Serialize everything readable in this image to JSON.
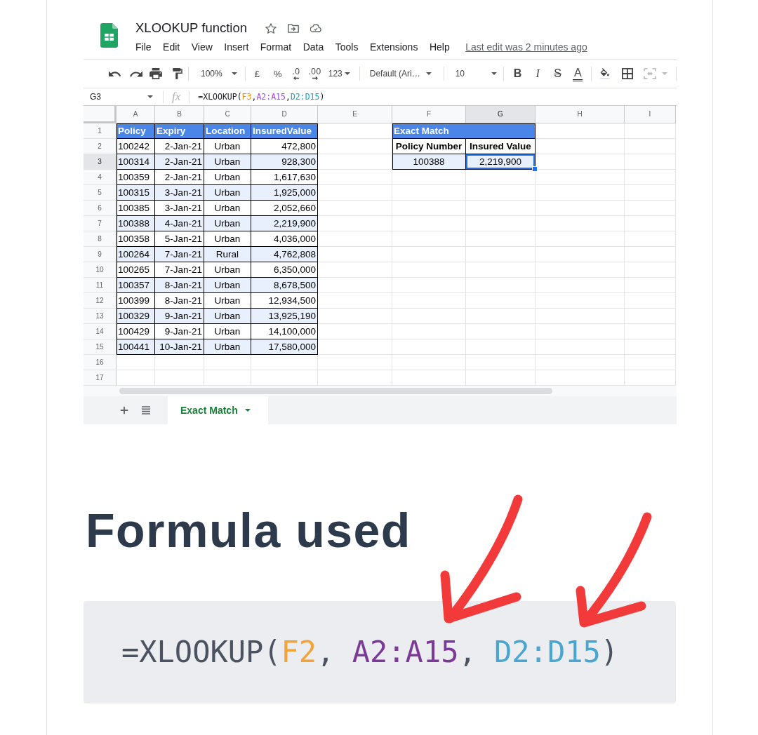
{
  "spreadsheet": {
    "title": "XLOOKUP function",
    "menu": [
      "File",
      "Edit",
      "View",
      "Insert",
      "Format",
      "Data",
      "Tools",
      "Extensions",
      "Help"
    ],
    "last_edit": "Last edit was 2 minutes ago",
    "toolbar": {
      "zoom": "100%",
      "currency": "£",
      "percent": "%",
      "decrease_decimals": ".0",
      "increase_decimals": ".00",
      "number_format": "123",
      "font": "Default (Ari…",
      "font_size": "10",
      "bold": "B",
      "italic": "I",
      "strikethrough": "S",
      "text_color": "A"
    },
    "formula_bar": {
      "cell_ref": "G3",
      "fx_label": "fx",
      "formula": [
        {
          "text": "=XLOOKUP("
        },
        {
          "text": "F3",
          "color": "#f09300"
        },
        {
          "text": ","
        },
        {
          "text": "A2:A15",
          "color": "#a142f4"
        },
        {
          "text": ","
        },
        {
          "text": "D2:D15",
          "color": "#12a4c4"
        },
        {
          "text": ")"
        }
      ]
    },
    "columns": [
      {
        "label": "A",
        "selected": false
      },
      {
        "label": "B",
        "selected": false
      },
      {
        "label": "C",
        "selected": false
      },
      {
        "label": "D",
        "selected": false
      },
      {
        "label": "E",
        "selected": false
      },
      {
        "label": "F",
        "selected": false
      },
      {
        "label": "G",
        "selected": true
      },
      {
        "label": "H",
        "selected": false
      },
      {
        "label": "I",
        "selected": false
      }
    ],
    "rows": [
      {
        "label": "1",
        "selected": false
      },
      {
        "label": "2",
        "selected": false
      },
      {
        "label": "3",
        "selected": true
      },
      {
        "label": "4",
        "selected": false
      },
      {
        "label": "5",
        "selected": false
      },
      {
        "label": "6",
        "selected": false
      },
      {
        "label": "7",
        "selected": false
      },
      {
        "label": "8",
        "selected": false
      },
      {
        "label": "9",
        "selected": false
      },
      {
        "label": "10",
        "selected": false
      },
      {
        "label": "11",
        "selected": false
      },
      {
        "label": "12",
        "selected": false
      },
      {
        "label": "13",
        "selected": false
      },
      {
        "label": "14",
        "selected": false
      },
      {
        "label": "15",
        "selected": false
      },
      {
        "label": "16",
        "selected": false
      },
      {
        "label": "17",
        "selected": false
      }
    ],
    "data_table": {
      "columns": [
        "Policy",
        "Expiry",
        "Location",
        "InsuredValue"
      ],
      "rows": [
        {
          "shaded": false,
          "cells": [
            "100242",
            "2-Jan-21",
            "Urban",
            "472,800"
          ]
        },
        {
          "shaded": true,
          "cells": [
            "100314",
            "2-Jan-21",
            "Urban",
            "928,300"
          ]
        },
        {
          "shaded": false,
          "cells": [
            "100359",
            "2-Jan-21",
            "Urban",
            "1,617,630"
          ]
        },
        {
          "shaded": true,
          "cells": [
            "100315",
            "3-Jan-21",
            "Urban",
            "1,925,000"
          ]
        },
        {
          "shaded": false,
          "cells": [
            "100385",
            "3-Jan-21",
            "Urban",
            "2,052,660"
          ]
        },
        {
          "shaded": true,
          "cells": [
            "100388",
            "4-Jan-21",
            "Urban",
            "2,219,900"
          ]
        },
        {
          "shaded": false,
          "cells": [
            "100358",
            "5-Jan-21",
            "Urban",
            "4,036,000"
          ]
        },
        {
          "shaded": true,
          "cells": [
            "100264",
            "7-Jan-21",
            "Rural",
            "4,762,808"
          ]
        },
        {
          "shaded": false,
          "cells": [
            "100265",
            "7-Jan-21",
            "Urban",
            "6,350,000"
          ]
        },
        {
          "shaded": true,
          "cells": [
            "100357",
            "8-Jan-21",
            "Urban",
            "8,678,500"
          ]
        },
        {
          "shaded": false,
          "cells": [
            "100399",
            "8-Jan-21",
            "Urban",
            "12,934,500"
          ]
        },
        {
          "shaded": true,
          "cells": [
            "100329",
            "9-Jan-21",
            "Urban",
            "13,925,190"
          ]
        },
        {
          "shaded": false,
          "cells": [
            "100429",
            "9-Jan-21",
            "Urban",
            "14,100,000"
          ]
        },
        {
          "shaded": true,
          "cells": [
            "100441",
            "10-Jan-21",
            "Urban",
            "17,580,000"
          ]
        }
      ]
    },
    "lookup_table": {
      "title": "Exact Match",
      "columns": [
        "Policy Number",
        "Insured Value"
      ],
      "rows": [
        {
          "shaded": true,
          "cells": [
            {
              "text": "100388",
              "selected": false
            },
            {
              "text": "2,219,900",
              "selected": true
            }
          ]
        }
      ]
    },
    "sheet_tabs": [
      {
        "label": "Exact Match",
        "selected": true
      }
    ]
  },
  "heading": "Formula used",
  "code": [
    {
      "text": "=XLOOKUP(",
      "color": "#4b5361"
    },
    {
      "text": "F2",
      "color": "#f2a33a"
    },
    {
      "text": ", ",
      "color": "#4b5361"
    },
    {
      "text": "A2:A15",
      "color": "#7b3a96"
    },
    {
      "text": ", ",
      "color": "#4b5361"
    },
    {
      "text": "D2:D15",
      "color": "#4aa5cf"
    },
    {
      "text": ")",
      "color": "#4b5361"
    }
  ]
}
